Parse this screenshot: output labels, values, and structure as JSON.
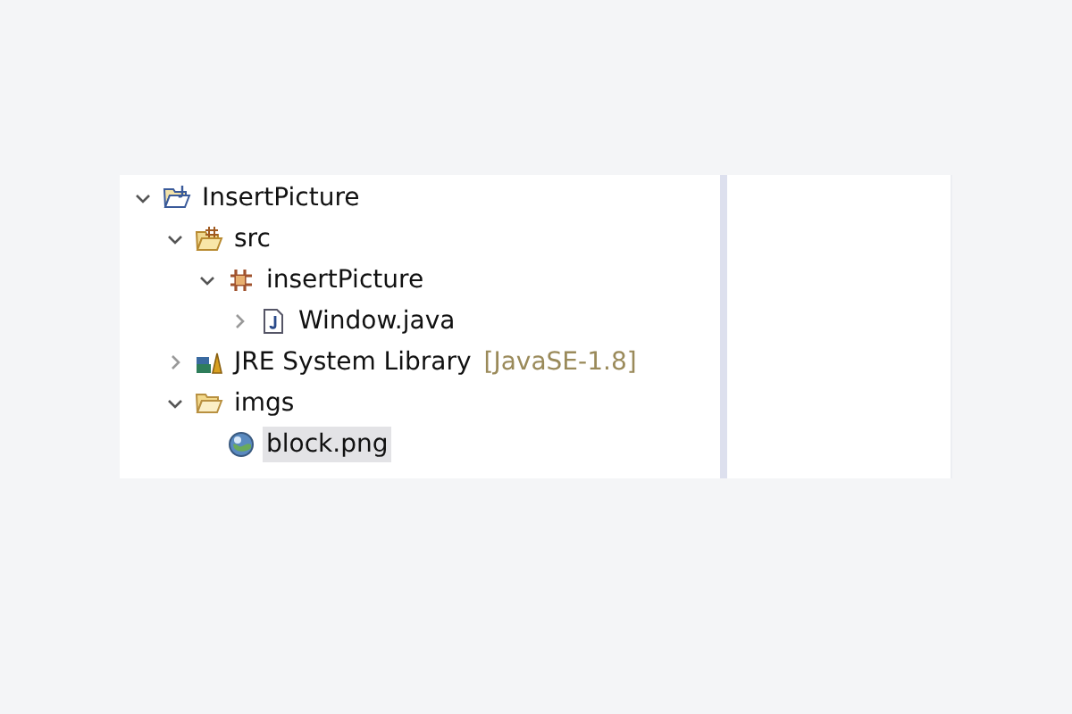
{
  "project_tree": [
    {
      "label": "InsertPicture",
      "kind": "project",
      "expanded": true,
      "selected": false,
      "children": [
        {
          "label": "src",
          "kind": "source-folder",
          "expanded": true,
          "selected": false,
          "children": [
            {
              "label": "insertPicture",
              "kind": "package",
              "expanded": true,
              "selected": false,
              "children": [
                {
                  "label": "Window.java",
                  "kind": "java-file",
                  "expanded": false,
                  "selected": false
                }
              ]
            }
          ]
        },
        {
          "label": "JRE System Library",
          "decoration": "[JavaSE-1.8]",
          "kind": "library",
          "expanded": false,
          "selected": false
        },
        {
          "label": "imgs",
          "kind": "folder",
          "expanded": true,
          "selected": false,
          "children": [
            {
              "label": "block.png",
              "kind": "image-file",
              "selected": true
            }
          ]
        }
      ]
    }
  ]
}
